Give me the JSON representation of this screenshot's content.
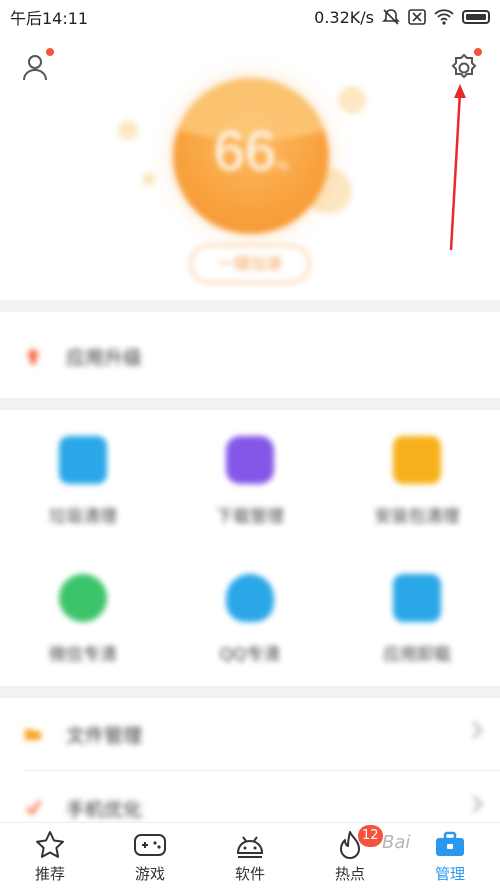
{
  "status_bar": {
    "time": "午后14:11",
    "network_speed": "0.32K/s",
    "icons": [
      "mute-icon",
      "sim-icon",
      "wifi-icon",
      "battery-icon"
    ]
  },
  "hero": {
    "score": "66",
    "score_unit": "%",
    "cleanup_button": "一键加速",
    "accent_color": "#f8a13c"
  },
  "list_top": {
    "app_upgrade": "应用升级"
  },
  "tools": [
    {
      "label": "垃圾清理",
      "icon": "trash-bin-icon",
      "color": "#2aa7e8"
    },
    {
      "label": "下载管理",
      "icon": "download-icon",
      "color": "#8457e8"
    },
    {
      "label": "安装包清理",
      "icon": "package-icon",
      "color": "#f7b11c"
    },
    {
      "label": "微信专清",
      "icon": "wechat-icon",
      "color": "#3cc46a"
    },
    {
      "label": "QQ专清",
      "icon": "qq-icon",
      "color": "#2aa7e8"
    },
    {
      "label": "应用卸载",
      "icon": "uninstall-icon",
      "color": "#2aa7e8"
    }
  ],
  "list_bottom": {
    "file_manager": "文件管理",
    "phone_clean": "手机优化"
  },
  "tabbar": {
    "tabs": [
      {
        "label": "推荐",
        "icon": "star-icon"
      },
      {
        "label": "游戏",
        "icon": "gamepad-icon"
      },
      {
        "label": "软件",
        "icon": "android-icon"
      },
      {
        "label": "热点",
        "icon": "flame-icon",
        "badge": "12"
      },
      {
        "label": "管理",
        "icon": "toolbox-icon",
        "active": true
      }
    ]
  },
  "watermark": "Bai"
}
